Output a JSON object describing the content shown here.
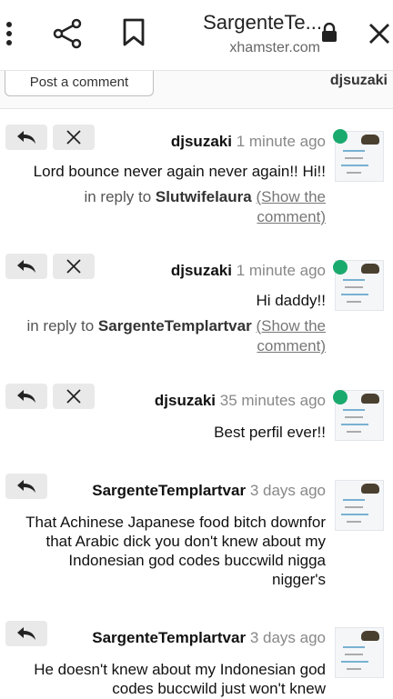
{
  "browser": {
    "title": "SargenteTe...",
    "url": "xhamster.com",
    "icons": [
      "more-vert-icon",
      "share-icon",
      "bookmark-icon",
      "lock-icon",
      "close-icon"
    ]
  },
  "comment_form": {
    "post_label": "Post a comment",
    "username": "djsuzaki"
  },
  "comments": [
    {
      "author": "djsuzaki",
      "time": "1 minute ago",
      "text": "Lord bounce never again never again!! Hi!!",
      "reply_prefix": "in reply to",
      "reply_to": "Slutwifelaura",
      "show_link": "(Show the comment)",
      "online": true,
      "removable": true
    },
    {
      "author": "djsuzaki",
      "time": "1 minute ago",
      "text": "Hi daddy!!",
      "reply_prefix": "in reply to",
      "reply_to": "SargenteTemplartvar",
      "show_link": "(Show the comment)",
      "online": true,
      "removable": true
    },
    {
      "author": "djsuzaki",
      "time": "35 minutes ago",
      "text": "Best perfil ever!!",
      "online": true,
      "removable": true
    },
    {
      "author": "SargenteTemplartvar",
      "time": "3 days ago",
      "text": "That Achinese Japanese food bitch downfor that Arabic dick you don't knew about my Indonesian god codes buccwild nigga nigger's",
      "online": false,
      "removable": false
    },
    {
      "author": "SargenteTemplartvar",
      "time": "3 days ago",
      "text": "He doesn't knew about my Indonesian god codes buccwild just won't knew",
      "online": false,
      "removable": false
    }
  ],
  "colors": {
    "online": "#1aaa6e",
    "button_bg": "#e9e9e9"
  }
}
